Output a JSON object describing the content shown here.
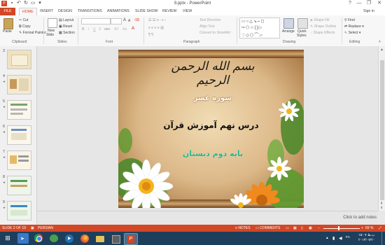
{
  "window": {
    "title": "9.pptx - PowerPoint",
    "controls": [
      "?",
      "—",
      "❐",
      "✕"
    ]
  },
  "tabs": [
    "FILE",
    "HOME",
    "INSERT",
    "DESIGN",
    "TRANSITIONS",
    "ANIMATIONS",
    "SLIDE SHOW",
    "REVIEW",
    "VIEW"
  ],
  "sign_in": "Sign in",
  "ribbon": {
    "clipboard": {
      "label": "Clipboard",
      "paste": "Paste",
      "cut": "Cut",
      "copy": "Copy",
      "format_painter": "Format Painter"
    },
    "slides": {
      "label": "Slides",
      "new_slide_1": "New",
      "new_slide_2": "Slide",
      "layout": "Layout",
      "reset": "Reset",
      "section": "Section"
    },
    "font": {
      "label": "Font"
    },
    "paragraph": {
      "label": "Paragraph",
      "text_direction": "Text Direction",
      "align_text": "Align Text",
      "convert_smartart": "Convert to SmartArt"
    },
    "drawing": {
      "label": "Drawing",
      "arrange": "Arrange",
      "quick_styles_1": "Quick",
      "quick_styles_2": "Styles",
      "shape_fill": "Shape Fill",
      "shape_outline": "Shape Outline",
      "shape_effects": "Shape Effects"
    },
    "editing": {
      "label": "Editing",
      "find": "Find",
      "replace": "Replace",
      "select": "Select"
    }
  },
  "thumbnails": [
    {
      "num": "3"
    },
    {
      "num": "4"
    },
    {
      "num": "5"
    },
    {
      "num": "6"
    },
    {
      "num": "7"
    },
    {
      "num": "8"
    },
    {
      "num": "9"
    }
  ],
  "slide": {
    "bismillah": "بسم الله الرحمن الرحيم",
    "surah": "سوره عصر",
    "lesson": "درس نهم آموزش قرآن",
    "grade": "پایه دوم دبستان"
  },
  "notes_placeholder": "Click to add notes",
  "status": {
    "slide_of": "SLIDE 2 OF 19",
    "language": "PERSIAN",
    "notes": "NOTES",
    "comments": "COMMENTS",
    "zoom": "69 %"
  },
  "taskbar": {
    "time": "۱۵:۰۷ ب.ظ",
    "date": "۲۰۱۴/۰۷/۲۰",
    "lang": "FA"
  },
  "colors": {
    "accent": "#d24726",
    "taskbar": "#1e3f5c"
  }
}
